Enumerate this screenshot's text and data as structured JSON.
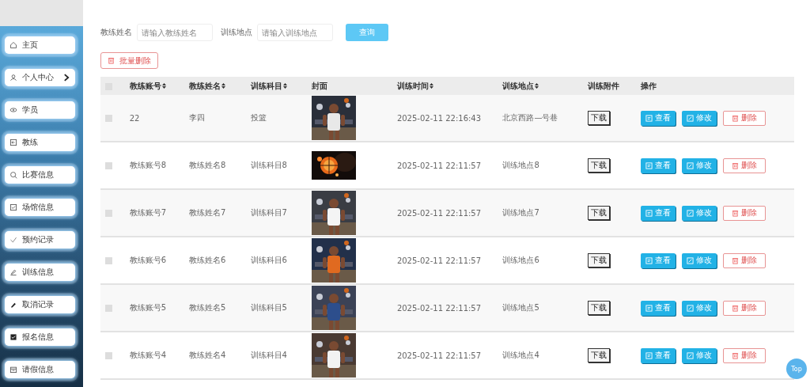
{
  "sidebar": {
    "items": [
      {
        "label": "主页",
        "collapsible": false
      },
      {
        "label": "个人中心",
        "collapsible": true
      },
      {
        "label": "学员",
        "collapsible": false
      },
      {
        "label": "教练",
        "collapsible": false
      },
      {
        "label": "比赛信息",
        "collapsible": false
      },
      {
        "label": "场馆信息",
        "collapsible": false
      },
      {
        "label": "预约记录",
        "collapsible": false
      },
      {
        "label": "训练信息",
        "collapsible": false
      },
      {
        "label": "取消记录",
        "collapsible": false
      },
      {
        "label": "报名信息",
        "collapsible": false
      },
      {
        "label": "请假信息",
        "collapsible": false
      }
    ]
  },
  "search": {
    "fields": [
      {
        "label": "教练姓名",
        "placeholder": "请输入教练姓名"
      },
      {
        "label": "训练地点",
        "placeholder": "请输入训练地点"
      }
    ],
    "button": "查询"
  },
  "batch_delete": "批量删除",
  "table": {
    "all_checked": false,
    "columns": [
      {
        "label": "教练账号",
        "sortable": true
      },
      {
        "label": "教练姓名",
        "sortable": true
      },
      {
        "label": "训练科目",
        "sortable": true
      },
      {
        "label": "封面",
        "sortable": false
      },
      {
        "label": "训练时间",
        "sortable": true
      },
      {
        "label": "训练地点",
        "sortable": true
      },
      {
        "label": "训练附件",
        "sortable": false
      },
      {
        "label": "操作",
        "sortable": false
      }
    ],
    "rows": [
      {
        "checked": false,
        "account": "22",
        "name": "李四",
        "subject": "投篮",
        "time": "2025-02-11 22:16:43",
        "location": "北京西路—号巷",
        "attachment": "下载",
        "actions": [
          {
            "kind": "view",
            "label": "查看"
          },
          {
            "kind": "edit",
            "label": "修改"
          },
          {
            "kind": "delete",
            "label": "删除"
          }
        ]
      },
      {
        "checked": false,
        "account": "教练账号8",
        "name": "教练姓名8",
        "subject": "训练科目8",
        "time": "2025-02-11 22:11:57",
        "location": "训练地点8",
        "attachment": "下载",
        "actions": [
          {
            "kind": "view",
            "label": "查看"
          },
          {
            "kind": "edit",
            "label": "修改"
          },
          {
            "kind": "delete",
            "label": "删除"
          }
        ]
      },
      {
        "checked": false,
        "account": "教练账号7",
        "name": "教练姓名7",
        "subject": "训练科目7",
        "time": "2025-02-11 22:11:57",
        "location": "训练地点7",
        "attachment": "下载",
        "actions": [
          {
            "kind": "view",
            "label": "查看"
          },
          {
            "kind": "edit",
            "label": "修改"
          },
          {
            "kind": "delete",
            "label": "删除"
          }
        ]
      },
      {
        "checked": false,
        "account": "教练账号6",
        "name": "教练姓名6",
        "subject": "训练科目6",
        "time": "2025-02-11 22:11:57",
        "location": "训练地点6",
        "attachment": "下载",
        "actions": [
          {
            "kind": "view",
            "label": "查看"
          },
          {
            "kind": "edit",
            "label": "修改"
          },
          {
            "kind": "delete",
            "label": "删除"
          }
        ]
      },
      {
        "checked": false,
        "account": "教练账号5",
        "name": "教练姓名5",
        "subject": "训练科目5",
        "time": "2025-02-11 22:11:57",
        "location": "训练地点5",
        "attachment": "下载",
        "actions": [
          {
            "kind": "view",
            "label": "查看"
          },
          {
            "kind": "edit",
            "label": "修改"
          },
          {
            "kind": "delete",
            "label": "删除"
          }
        ]
      },
      {
        "checked": false,
        "account": "教练账号4",
        "name": "教练姓名4",
        "subject": "训练科目4",
        "time": "2025-02-11 22:11:57",
        "location": "训练地点4",
        "attachment": "下载",
        "actions": [
          {
            "kind": "view",
            "label": "查看"
          },
          {
            "kind": "edit",
            "label": "修改"
          },
          {
            "kind": "delete",
            "label": "删除"
          }
        ]
      }
    ]
  },
  "back_to_top": "Top"
}
